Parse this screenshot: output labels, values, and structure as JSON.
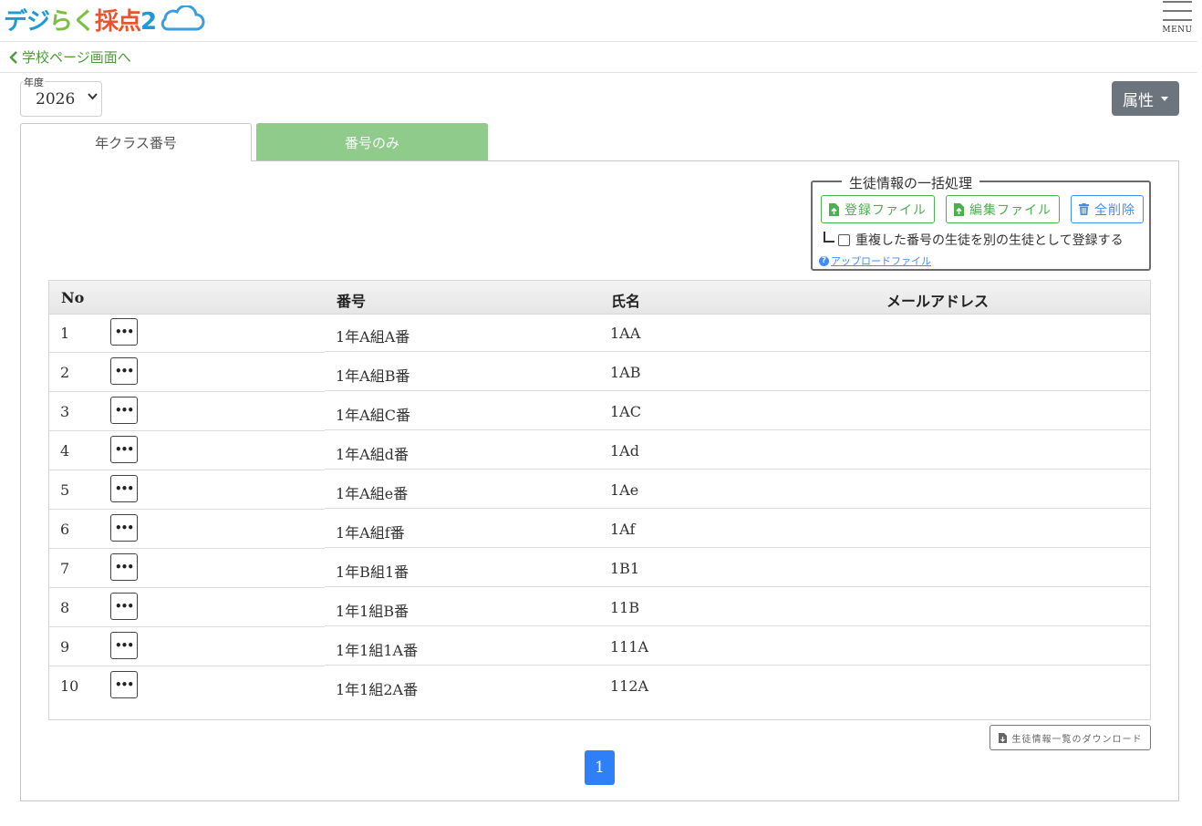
{
  "header": {
    "logo_text": "デジらく採点2",
    "menu_label": "MENU"
  },
  "nav": {
    "back_link": "学校ページ画面へ"
  },
  "filters": {
    "year_label": "年度",
    "year_value": "2026",
    "attribute_button": "属性"
  },
  "tabs": [
    {
      "label": "年クラス番号",
      "active": true
    },
    {
      "label": "番号のみ",
      "active": false
    }
  ],
  "bulk": {
    "legend": "生徒情報の一括処理",
    "register_file": "登録ファイル",
    "edit_file": "編集ファイル",
    "delete_all": "全削除",
    "duplicate_label": "重複した番号の生徒を別の生徒として登録する",
    "help_link": "アップロードファイル"
  },
  "table": {
    "headers": {
      "no": "No",
      "number": "番号",
      "name": "氏名",
      "email": "メールアドレス"
    },
    "rows": [
      {
        "no": "1",
        "number": "1年A組A番",
        "name": "1AA",
        "email": ""
      },
      {
        "no": "2",
        "number": "1年A組B番",
        "name": "1AB",
        "email": ""
      },
      {
        "no": "3",
        "number": "1年A組C番",
        "name": "1AC",
        "email": ""
      },
      {
        "no": "4",
        "number": "1年A組d番",
        "name": "1Ad",
        "email": ""
      },
      {
        "no": "5",
        "number": "1年A組e番",
        "name": "1Ae",
        "email": ""
      },
      {
        "no": "6",
        "number": "1年A組f番",
        "name": "1Af",
        "email": ""
      },
      {
        "no": "7",
        "number": "1年B組1番",
        "name": "1B1",
        "email": ""
      },
      {
        "no": "8",
        "number": "1年1組B番",
        "name": "11B",
        "email": ""
      },
      {
        "no": "9",
        "number": "1年1組1A番",
        "name": "111A",
        "email": ""
      },
      {
        "no": "10",
        "number": "1年1組2A番",
        "name": "112A",
        "email": ""
      }
    ]
  },
  "download_button": "生徒情報一覧のダウンロード",
  "pagination": {
    "current_page": "1"
  },
  "colors": {
    "brand_green": "#4f9a3a",
    "tab_inactive": "#8fcb8a",
    "primary_blue": "#2f80f6",
    "attr_gray": "#6c757d"
  },
  "icons": {
    "menu": "hamburger-icon",
    "back": "chevron-left-icon",
    "register": "file-upload-icon",
    "edit": "file-upload-icon",
    "delete": "trash-icon",
    "help": "question-circle-icon",
    "download": "file-download-icon",
    "row_menu": "ellipsis-icon"
  }
}
